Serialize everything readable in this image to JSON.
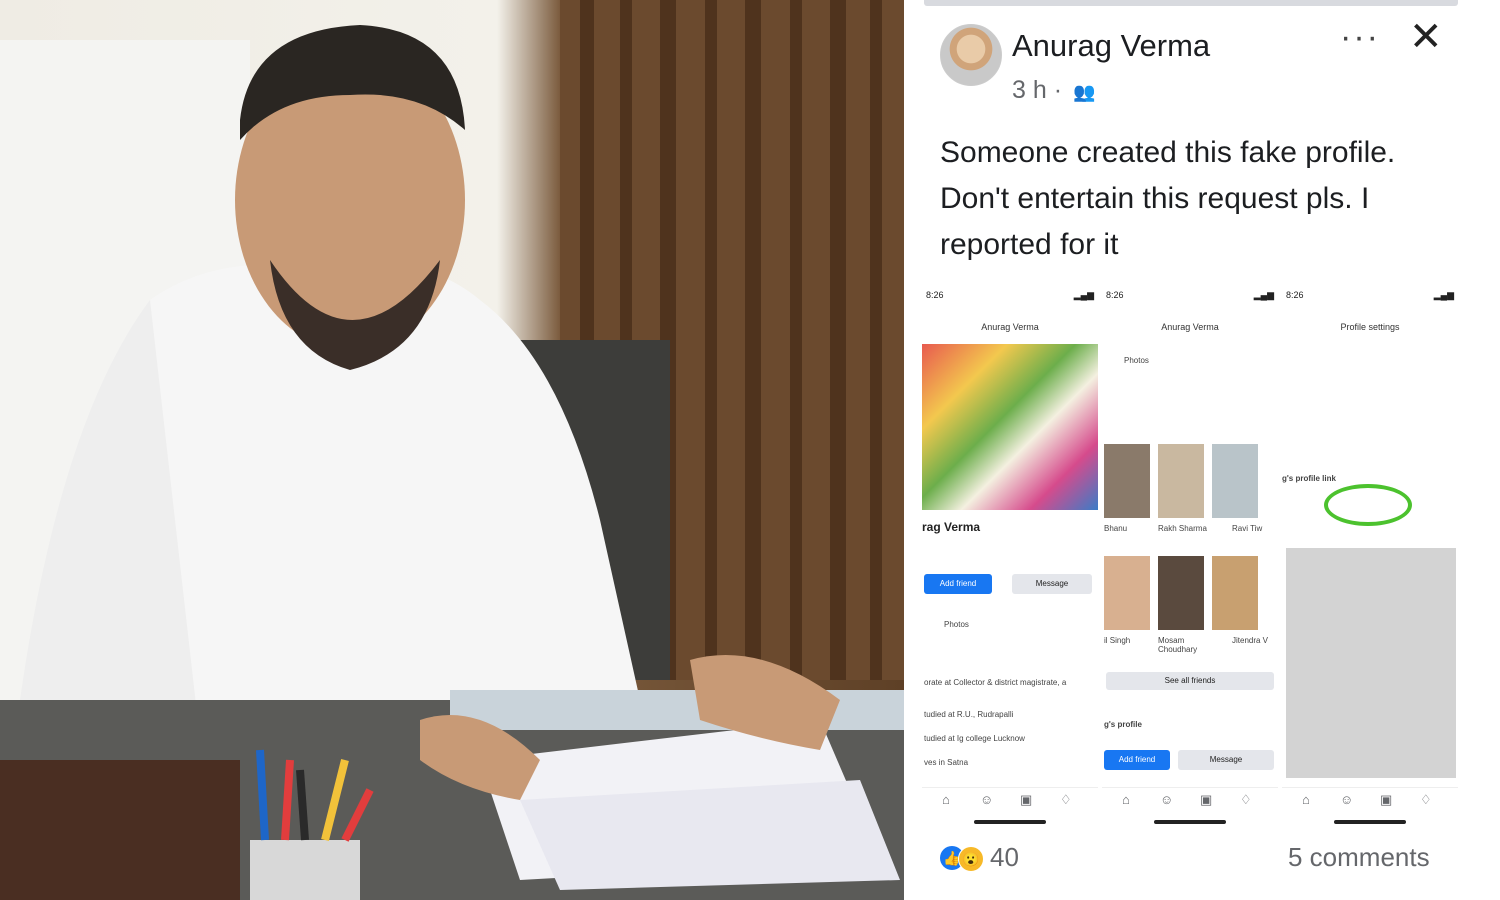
{
  "post": {
    "author": "Anurag Verma",
    "time": "3 h",
    "audience_icon": "friends-icon",
    "text": "Someone created this fake profile. Don't entertain this request pls. I reported for it",
    "reactions_count": "40",
    "comments": "5 comments",
    "reaction_icons": [
      "like-icon",
      "wow-icon"
    ]
  },
  "screenshots": {
    "status_time": "8:26",
    "shot1": {
      "title": "Anurag Verma",
      "name": "rag Verma",
      "add_friend": "Add friend",
      "message": "Message",
      "photos": "Photos",
      "lines": [
        "orate at Collector & district magistrate, a",
        "tudied at R.U., Rudrapalli",
        "tudied at Ig college Lucknow",
        "ves in Satna"
      ]
    },
    "shot2": {
      "title": "Anurag Verma",
      "photos": "Photos",
      "names_row1": [
        "Bhanu",
        "Rakh Sharma",
        "Ravi Tiw"
      ],
      "names_row2": [
        "il Singh",
        "Mosam Choudhary",
        "Jitendra V"
      ],
      "see_all": "See all friends",
      "profile_label": "g's profile",
      "add_friend": "Add friend",
      "message": "Message"
    },
    "shot3": {
      "title": "Profile settings",
      "link_label": "g's profile link"
    }
  },
  "colors": {
    "accent": "#1877f2",
    "highlight_circle": "#4cc22e"
  }
}
